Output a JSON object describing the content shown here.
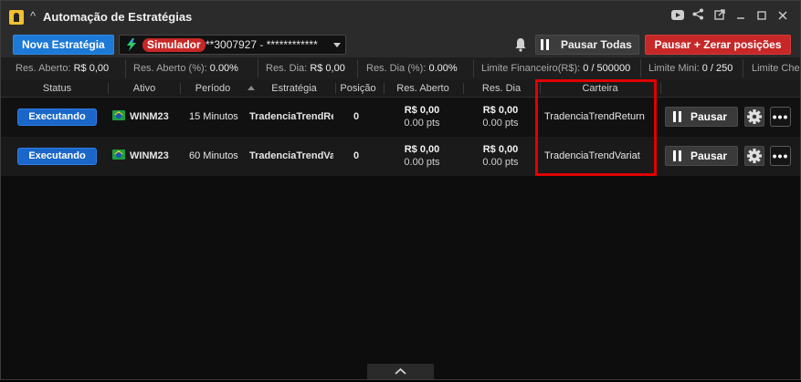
{
  "window": {
    "title": "Automação de Estratégias",
    "title_icons": [
      "youtube-icon",
      "share-icon",
      "external-link-icon",
      "minimize-icon",
      "maximize-icon",
      "close-icon"
    ]
  },
  "toolbar": {
    "new_strategy": "Nova Estratégia",
    "account_badge": "Simulador",
    "account_id": "**3007927 - ************",
    "pause_all": "Pausar Todas",
    "pause_zero": "Pausar + Zerar posições"
  },
  "stats": [
    {
      "label": "Res. Aberto:",
      "value": "R$ 0,00"
    },
    {
      "label": "Res. Aberto (%):",
      "value": "0.00%"
    },
    {
      "label": "Res. Dia:",
      "value": "R$ 0,00"
    },
    {
      "label": "Res. Dia (%):",
      "value": "0.00%"
    },
    {
      "label": "Limite Financeiro(R$):",
      "value": "0 / 500000"
    },
    {
      "label": "Limite Mini:",
      "value": "0 / 250"
    },
    {
      "label": "Limite Che",
      "value": ""
    }
  ],
  "table": {
    "headers": [
      "Status",
      "Ativo",
      "Período",
      "Estratégia",
      "Posição",
      "Res. Aberto",
      "Res. Dia",
      "Carteira"
    ],
    "rows": [
      {
        "status": "Executando",
        "asset": "WINM23",
        "period": "15 Minutos",
        "strategy": "TradenciaTrendRe",
        "position": "0",
        "open_brl": "R$ 0,00",
        "open_pts": "0.00 pts",
        "day_brl": "R$ 0,00",
        "day_pts": "0.00 pts",
        "wallet": "TradenciaTrendReturn",
        "pause": "Pausar"
      },
      {
        "status": "Executando",
        "asset": "WINM23",
        "period": "60 Minutos",
        "strategy": "TradenciaTrendVa",
        "position": "0",
        "open_brl": "R$ 0,00",
        "open_pts": "0.00 pts",
        "day_brl": "R$ 0,00",
        "day_pts": "0.00 pts",
        "wallet": "TradenciaTrendVariat",
        "pause": "Pausar"
      }
    ]
  },
  "colors": {
    "accent_blue": "#1c79d6",
    "danger_red": "#c62828",
    "highlight": "#e10000"
  }
}
